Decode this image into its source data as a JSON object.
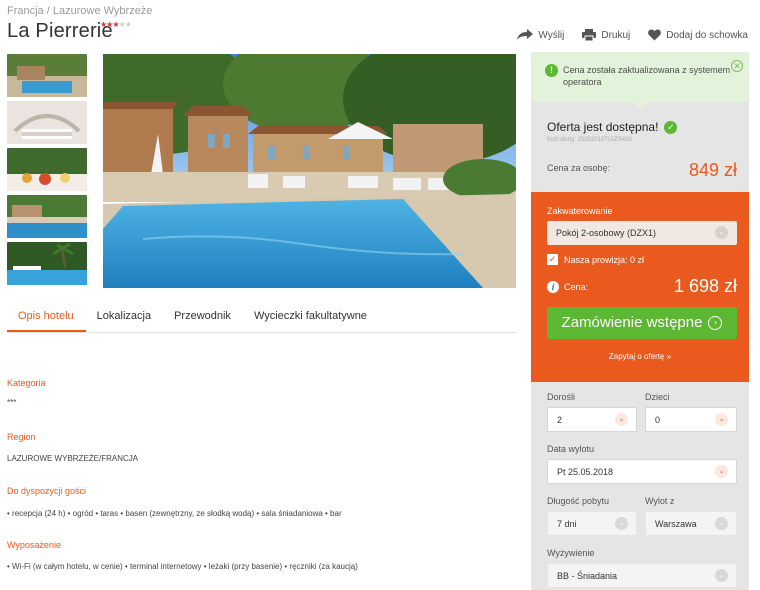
{
  "breadcrumb": {
    "country": "Francja",
    "sep": "/",
    "region": "Lazurowe Wybrzeże"
  },
  "hotel": {
    "name": "La Pierrerie",
    "stars_on": "★★★",
    "stars_off": "★★"
  },
  "actions": {
    "send": "Wyślij",
    "print": "Drukuj",
    "save": "Dodaj do schowka"
  },
  "tabs": [
    {
      "label": "Opis hotelu"
    },
    {
      "label": "Lokalizacja"
    },
    {
      "label": "Przewodnik"
    },
    {
      "label": "Wycieczki fakultatywne"
    }
  ],
  "sections": {
    "category_h": "Kategoria",
    "category_t": "***",
    "region_h": "Region",
    "region_t": "LAZUROWE WYBRZEŻE/FRANCJA",
    "amenities_h": "Do dyspozycji gości",
    "amenities_t": "• recepcja (24 h) • ogród • taras • basen (zewnętrzny, ze słodką wodą) • sala śniadaniowa • bar",
    "equipment_h": "Wyposażenie",
    "equipment_t": "• Wi-Fi (w całym hotelu, w cenie) • terminal internetowy • leżaki (przy basenie) • ręczniki (za kaucją)"
  },
  "notice": {
    "text": "Cena została zaktualizowana z systemem operatora"
  },
  "offer": {
    "available": "Oferta jest dostępna!",
    "code": "Kod oferty: 25052018TUIZS428",
    "per_person_label": "Cena za osobę:",
    "per_person_price": "849 zł"
  },
  "booking": {
    "accommodation_label": "Zakwaterowanie",
    "accommodation_value": "Pokój 2-osobowy (DZX1)",
    "commission": "Nasza prowizja: 0 zł",
    "price_label": "Cena:",
    "price_total": "1 698 zł",
    "order_button": "Zamówienie wstępne",
    "ask_link": "Zapytaj o ofertę »"
  },
  "form": {
    "adults_label": "Dorośli",
    "adults_value": "2",
    "children_label": "Dzieci",
    "children_value": "0",
    "departure_label": "Data wylotu",
    "departure_value": "Pt 25.05.2018",
    "length_label": "Długość pobytu",
    "length_value": "7 dni",
    "from_label": "Wylot z",
    "from_value": "Warszawa",
    "board_label": "Wyżywienie",
    "board_value": "BB - Śniadania"
  },
  "colors": {
    "accent": "#ea5a1f",
    "green": "#5cb832",
    "panel_grey": "#e5e5e5",
    "notice_bg": "#e3f2da"
  }
}
